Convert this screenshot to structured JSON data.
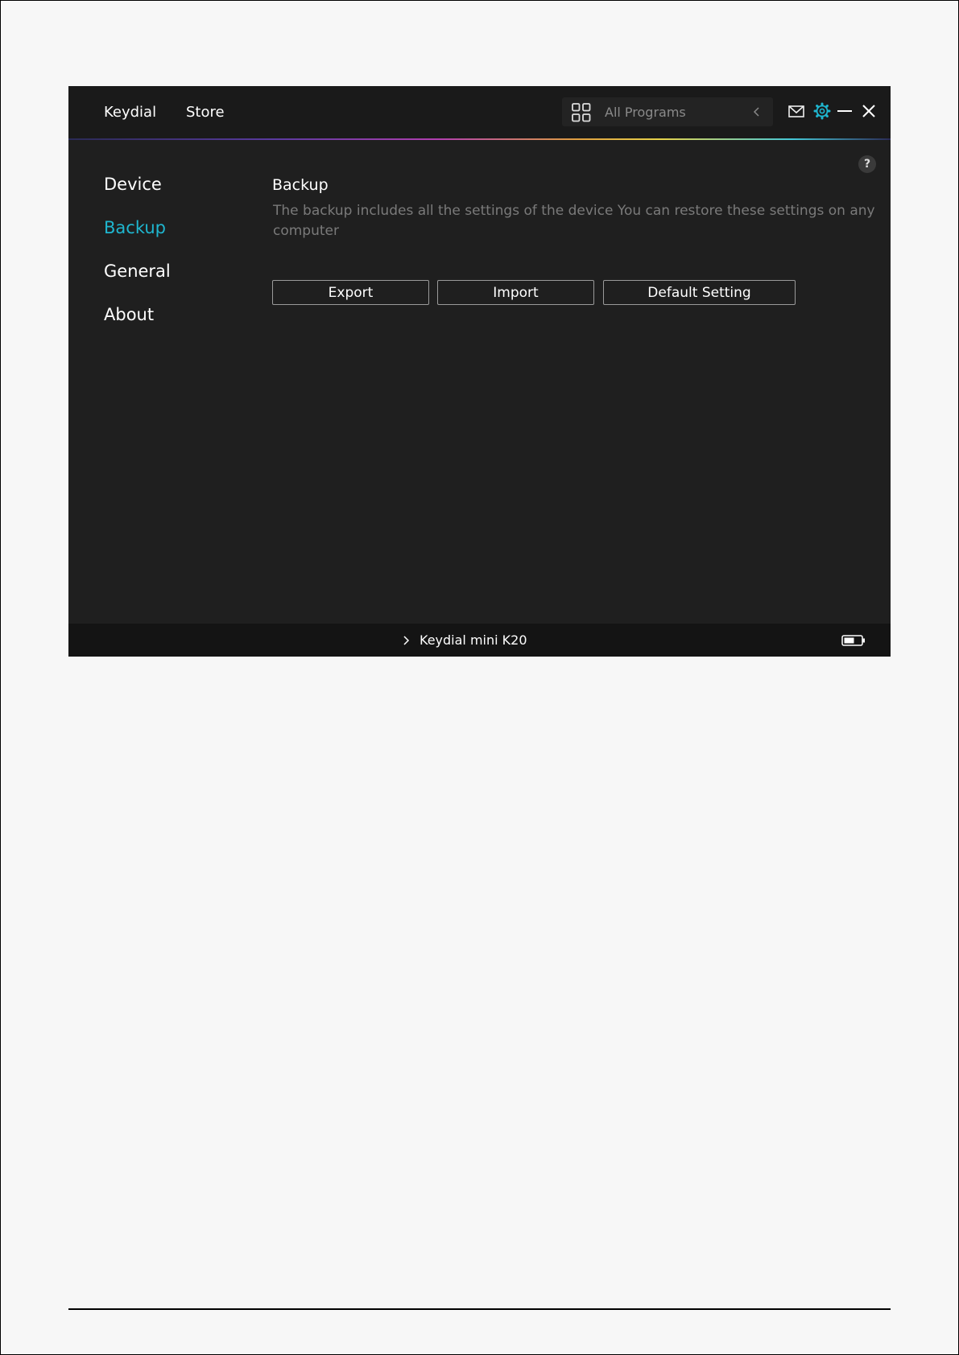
{
  "titlebar": {
    "nav": [
      "Keydial",
      "Store"
    ],
    "program_select": {
      "value": "All Programs"
    }
  },
  "sidebar": {
    "items": [
      {
        "label": "Device"
      },
      {
        "label": "Backup"
      },
      {
        "label": "General"
      },
      {
        "label": "About"
      }
    ],
    "active": "Backup"
  },
  "main": {
    "help_label": "?",
    "title": "Backup",
    "description": "The backup includes all the settings of the device You can restore these settings  on any computer",
    "buttons": {
      "export": "Export",
      "import": "Import",
      "default": "Default Setting"
    }
  },
  "statusbar": {
    "device_name": "Keydial mini K20"
  },
  "icons": [
    "grid-icon",
    "chevron-left-icon",
    "mail-icon",
    "gear-icon",
    "minimize-icon",
    "close-icon",
    "help-icon",
    "chevron-right-icon",
    "battery-icon"
  ],
  "colors": {
    "accent": "#1fb6cf",
    "window_bg": "#1f1f1f",
    "titlebar_bg": "#1a1a1a",
    "muted_text": "#7a7a7a",
    "page_bg": "#f7f7f7"
  }
}
